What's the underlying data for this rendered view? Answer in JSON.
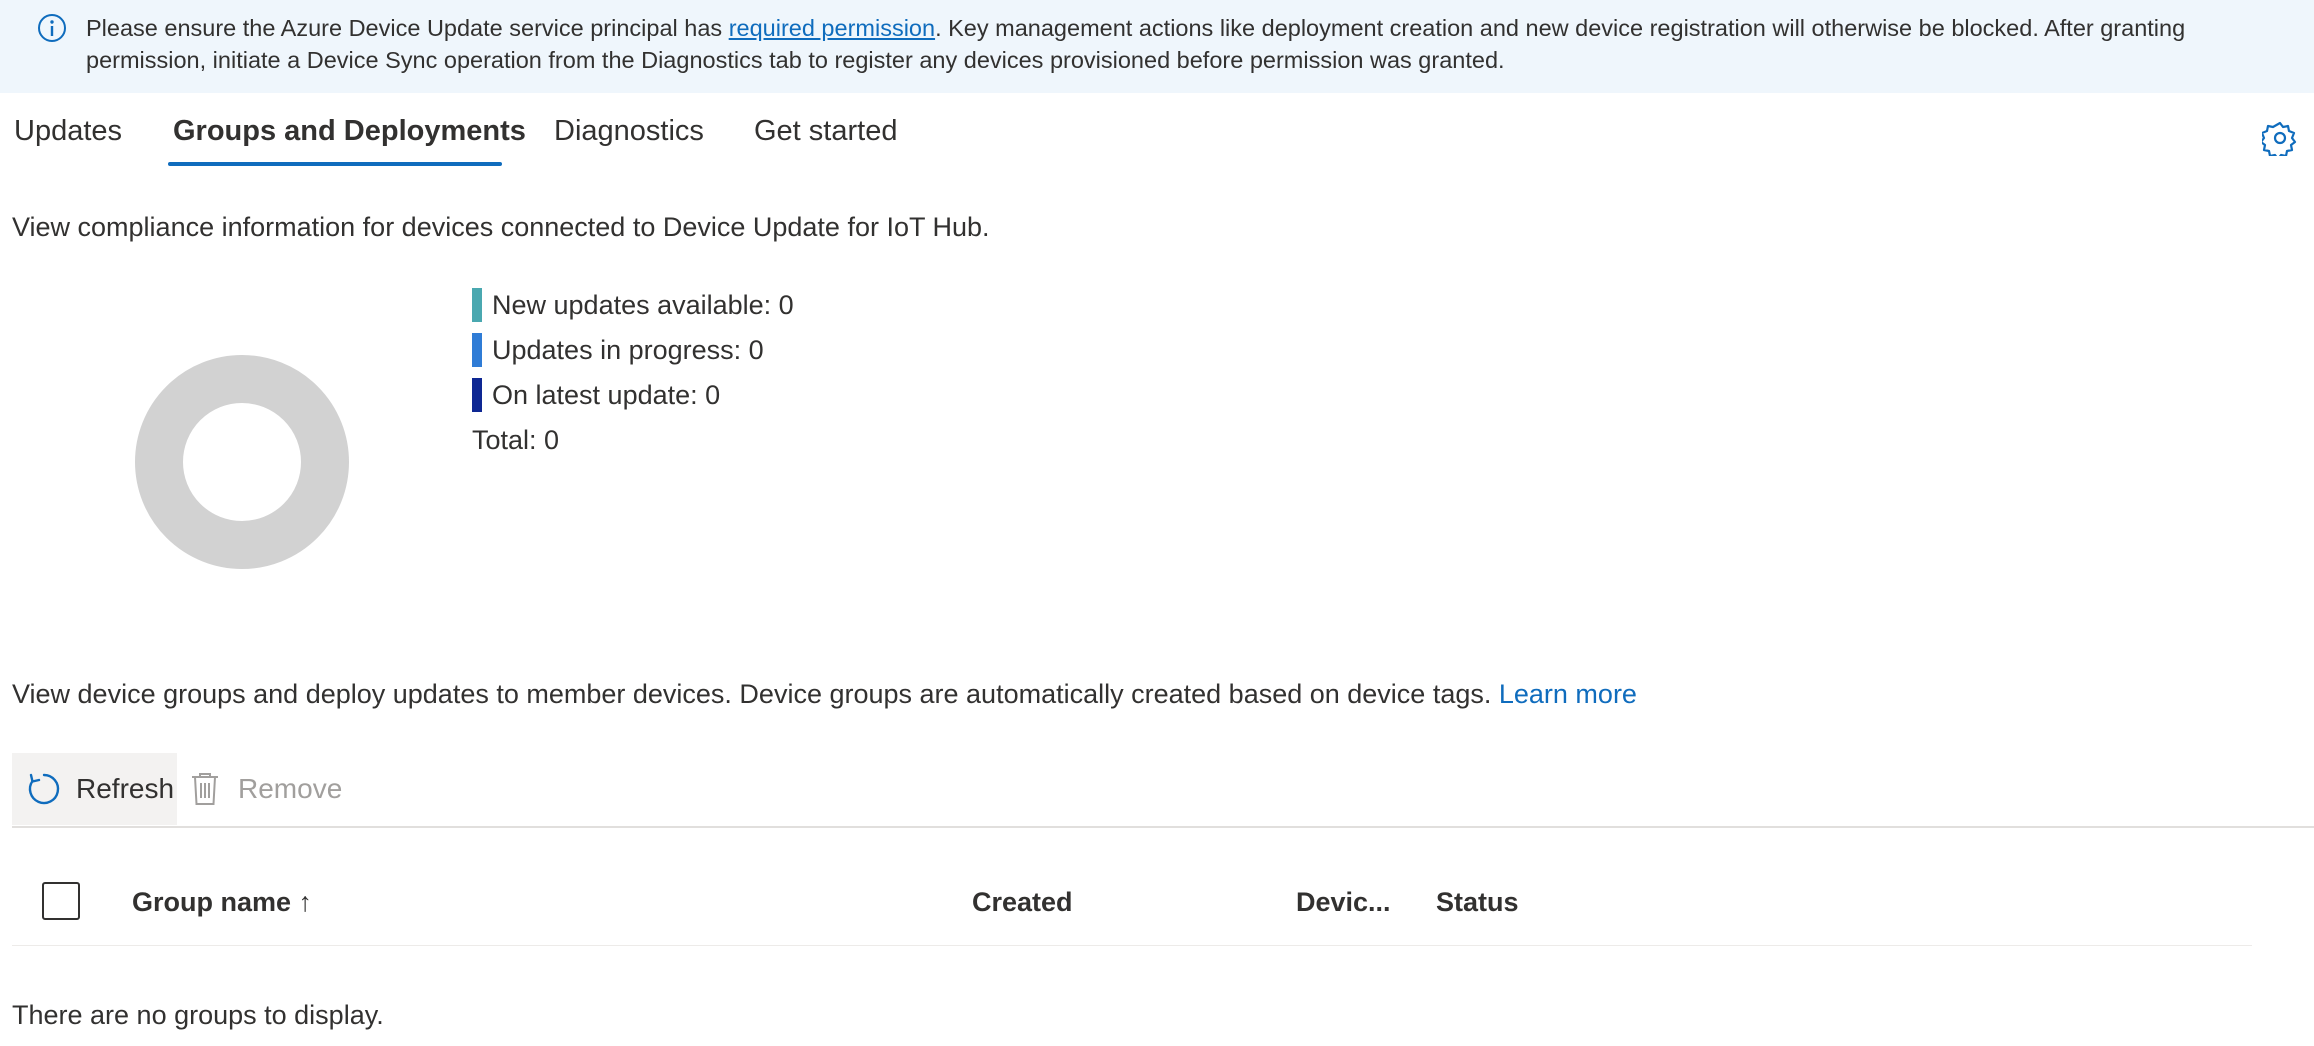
{
  "banner": {
    "text_before": "Please ensure the Azure Device Update service principal has ",
    "link": "required permission",
    "text_after": ". Key management actions like deployment creation and new device registration will otherwise be blocked. After granting permission, initiate a Device Sync operation from the Diagnostics tab to register any devices provisioned before permission was granted.",
    "icon": "info-icon"
  },
  "tabs": [
    {
      "label": "Updates"
    },
    {
      "label": "Groups and Deployments",
      "active": true
    },
    {
      "label": "Diagnostics"
    },
    {
      "label": "Get started"
    }
  ],
  "settings_icon": "gear-icon",
  "compliance": {
    "description": "View compliance information for devices connected to Device Update for IoT Hub.",
    "legend": [
      {
        "label": "New updates available: 0",
        "color": "#4aa8b0"
      },
      {
        "label": "Updates in progress: 0",
        "color": "#2f7cd6"
      },
      {
        "label": "On latest update: 0",
        "color": "#0e2793"
      }
    ],
    "total": "Total: 0",
    "donut_empty_color": "#d2d2d2"
  },
  "groups": {
    "description": "View device groups and deploy updates to member devices. Device groups are automatically created based on device tags.",
    "learn_more": "Learn more"
  },
  "toolbar": {
    "refresh_label": "Refresh",
    "remove_label": "Remove"
  },
  "table": {
    "columns": [
      "Group name ↑",
      "Created",
      "Devic...",
      "Status"
    ],
    "empty_message": "There are no groups to display."
  },
  "colors": {
    "accent": "#0f6cbd",
    "banner_bg": "#eff6fc",
    "disabled": "#a19f9d"
  }
}
